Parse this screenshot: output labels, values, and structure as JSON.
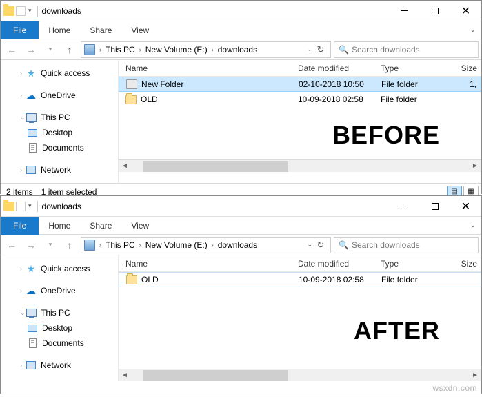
{
  "captions": {
    "before": "BEFORE",
    "after": "AFTER"
  },
  "titlebar": {
    "title": "downloads"
  },
  "ribbon": {
    "file": "File",
    "home": "Home",
    "share": "Share",
    "view": "View"
  },
  "breadcrumbs": {
    "this_pc": "This PC",
    "volume": "New Volume (E:)",
    "folder": "downloads"
  },
  "search": {
    "placeholder": "Search downloads"
  },
  "sidebar": {
    "quick_access": "Quick access",
    "onedrive": "OneDrive",
    "this_pc": "This PC",
    "desktop": "Desktop",
    "documents": "Documents",
    "network": "Network"
  },
  "columns": {
    "name": "Name",
    "date": "Date modified",
    "type": "Type",
    "size": "Size"
  },
  "before": {
    "rows": [
      {
        "name": "New Folder",
        "date": "02-10-2018 10:50",
        "type": "File folder",
        "size": "1,"
      },
      {
        "name": "OLD",
        "date": "10-09-2018 02:58",
        "type": "File folder",
        "size": ""
      }
    ],
    "status": {
      "items": "2 items",
      "selected": "1 item selected"
    }
  },
  "after": {
    "rows": [
      {
        "name": "OLD",
        "date": "10-09-2018 02:58",
        "type": "File folder",
        "size": ""
      }
    ]
  },
  "watermark": "wsxdn.com"
}
